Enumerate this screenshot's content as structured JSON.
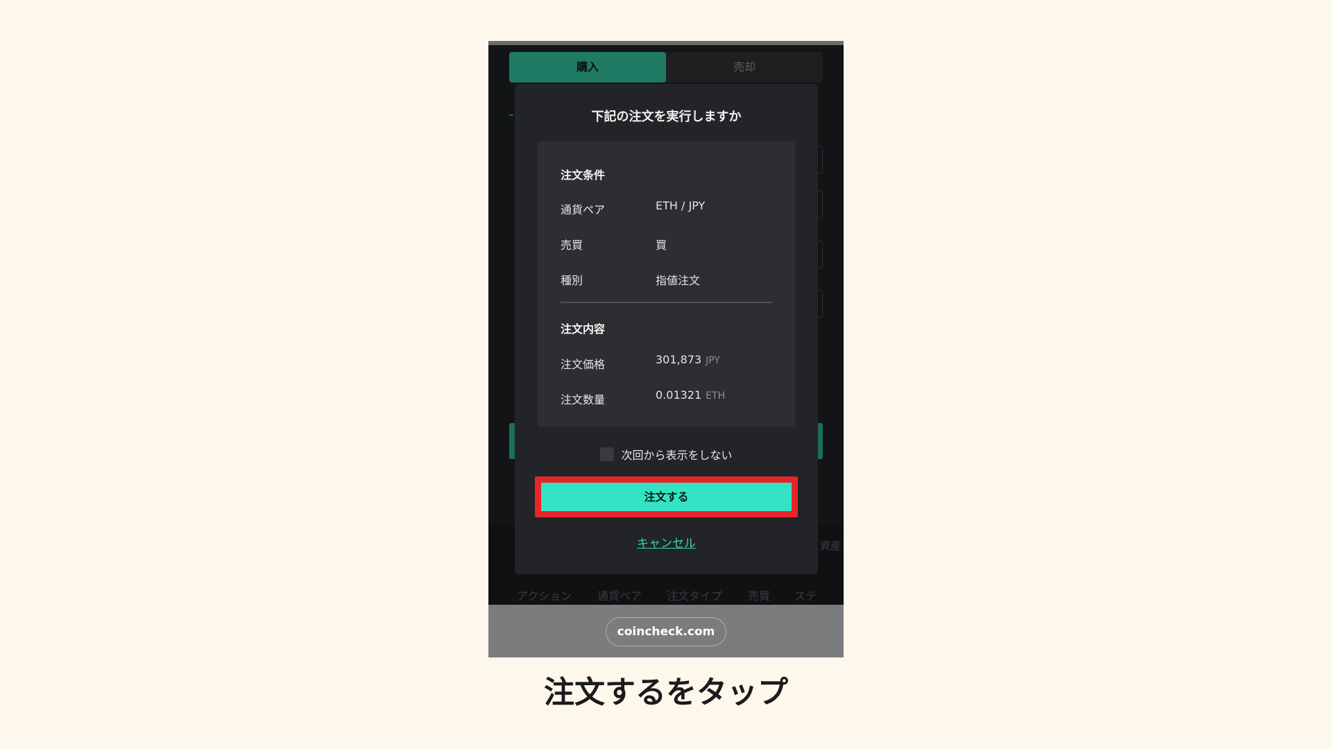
{
  "tabs": {
    "buy": "購入",
    "sell": "売却"
  },
  "modal": {
    "title": "下記の注文を実行しますか",
    "conditions_title": "注文条件",
    "conditions": [
      {
        "label": "通貨ペア",
        "value": "ETH / JPY"
      },
      {
        "label": "売買",
        "value": "買"
      },
      {
        "label": "種別",
        "value": "指値注文"
      }
    ],
    "content_title": "注文内容",
    "content": [
      {
        "label": "注文価格",
        "value": "301,873",
        "unit": "JPY"
      },
      {
        "label": "注文数量",
        "value": "0.01321",
        "unit": "ETH"
      }
    ],
    "checkbox_label": "次回から表示をしない",
    "checkbox_checked": false,
    "order_button": "注文する",
    "cancel_link": "キャンセル"
  },
  "background": {
    "column_headers": [
      "アクション",
      "通貨ペア",
      "注文タイプ",
      "売買",
      "ステ"
    ],
    "asset_fragment": "資産"
  },
  "url": "coincheck.com",
  "caption": "注文するをタップ",
  "colors": {
    "page_bg": "#fdf7ec",
    "accent": "#33e3c3",
    "highlight": "#e8252b",
    "buy_tab": "#1f7a63"
  }
}
